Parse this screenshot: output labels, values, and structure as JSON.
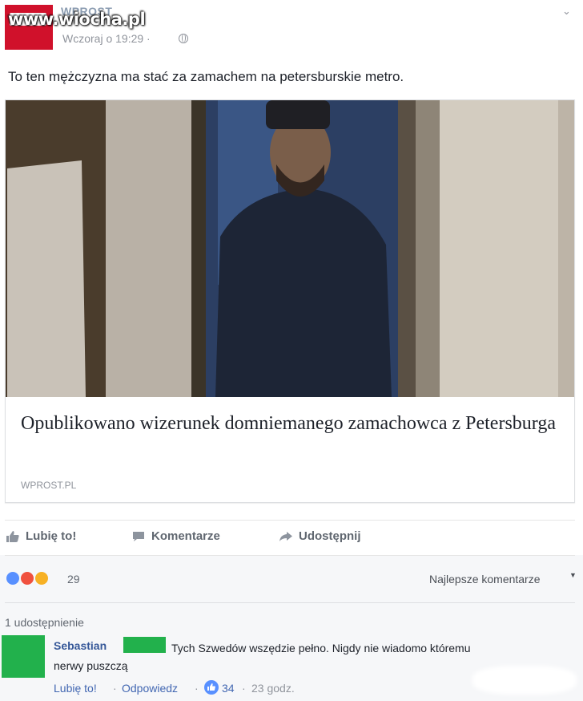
{
  "header": {
    "watermark": "www.wiocha.pl",
    "page_name": "WPROST",
    "time": "Wczoraj o 19:29 ·"
  },
  "post": {
    "text": "To ten mężczyzna ma stać za zamachem na petersburskie metro."
  },
  "link_card": {
    "title": "Opublikowano wizerunek domniemanego zamachowca z Petersburga",
    "domain": "WPROST.PL"
  },
  "actions": {
    "like": "Lubię to!",
    "comment": "Komentarze",
    "share": "Udostępnij"
  },
  "reactions": {
    "count": "29",
    "sort_label": "Najlepsze komentarze"
  },
  "shares": "1 udostępnienie",
  "comment": {
    "author": "Sebastian",
    "text_line1": "Tych Szwedów wszędzie pełno. Nigdy nie wiadomo któremu",
    "text_line2": "nerwy puszczą",
    "like_link": "Lubię to!",
    "reply_link": "Odpowiedz",
    "sep": "·",
    "likes": "34",
    "time": "23 godz."
  },
  "colors": {
    "brand_red": "#d0112b",
    "link_blue": "#4267b2",
    "redaction_green": "#22b14c"
  }
}
